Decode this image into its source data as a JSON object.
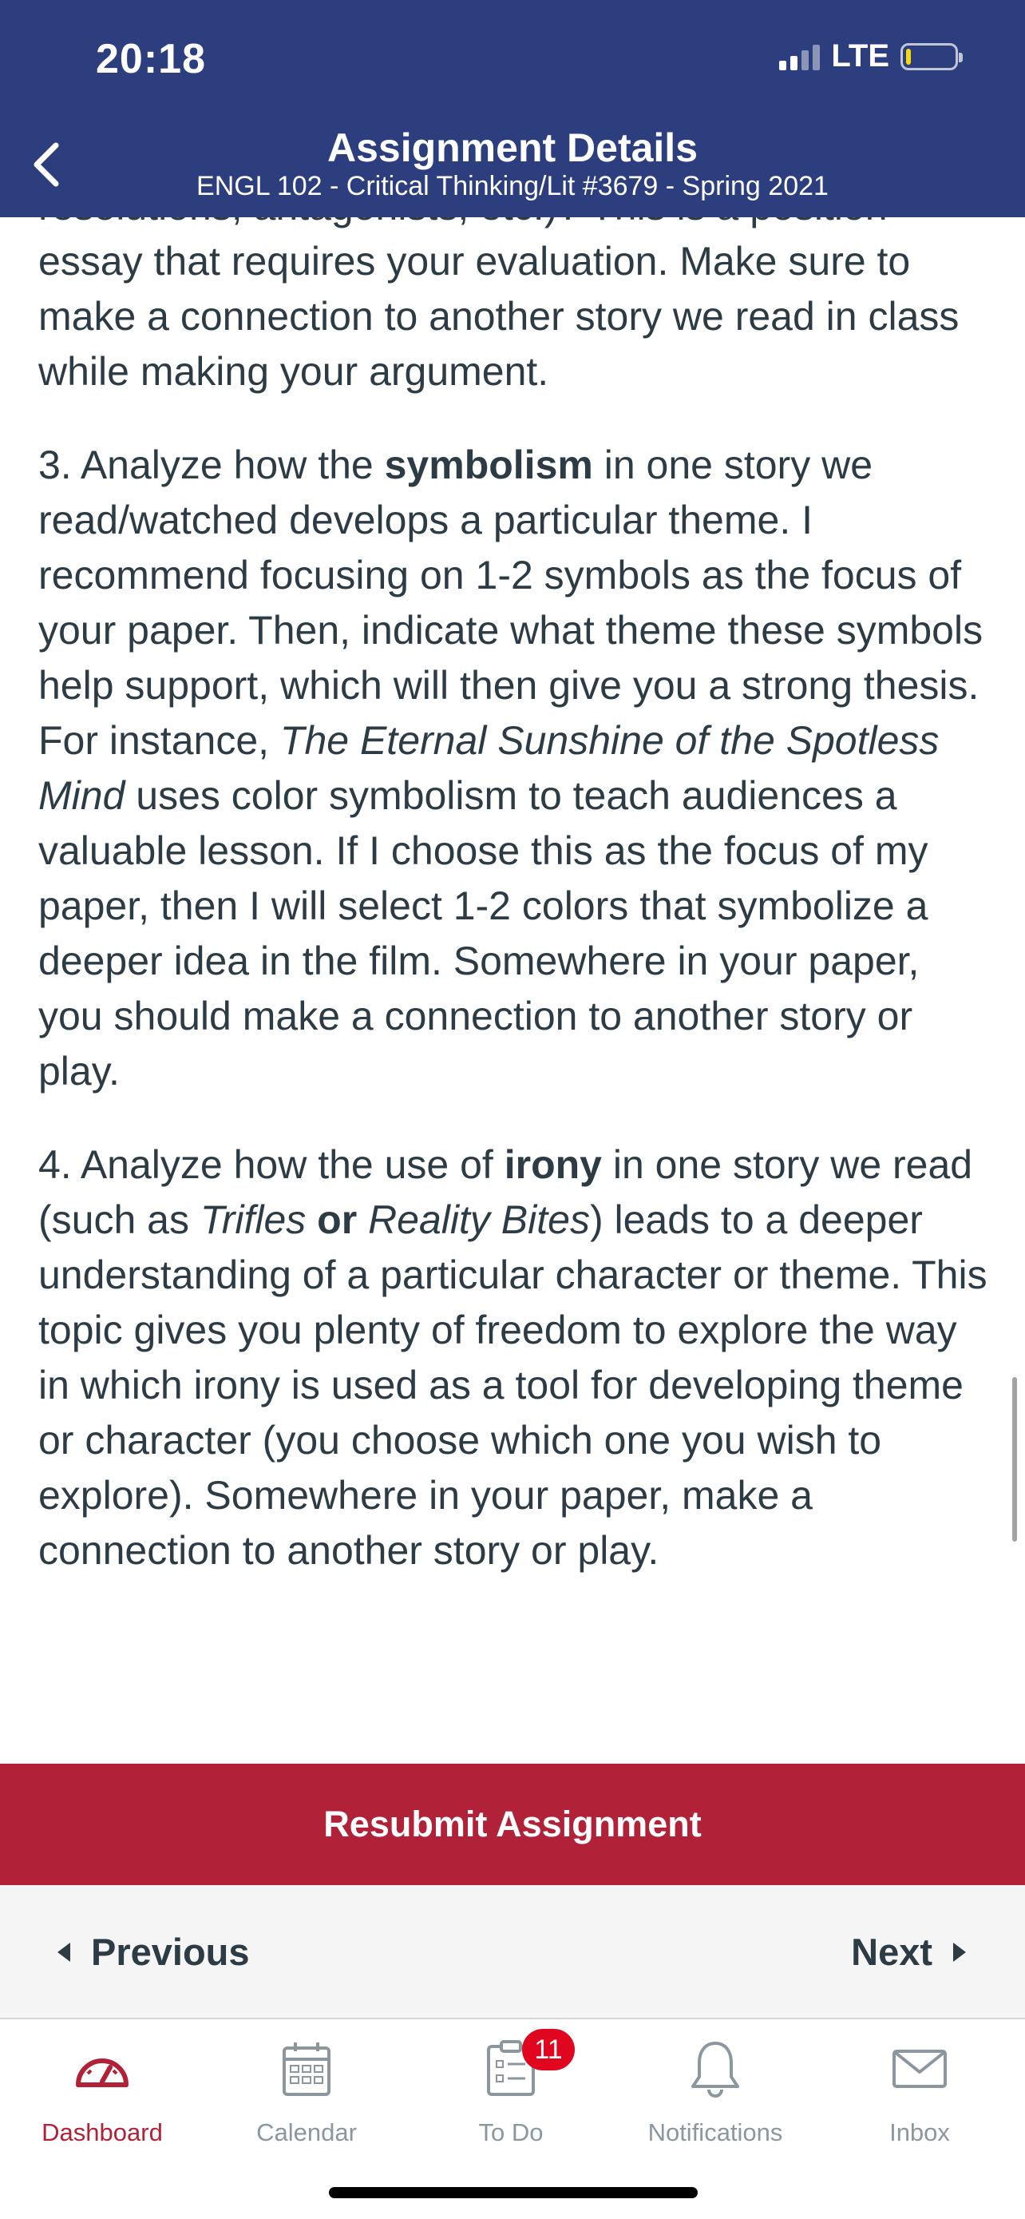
{
  "status_bar": {
    "time": "20:18",
    "network": "LTE",
    "battery_level": 0.1
  },
  "header": {
    "title": "Assignment Details",
    "subtitle": "ENGL 102 - Critical Thinking/Lit #3679 - Spring 2021",
    "back_icon": "chevron-left-icon"
  },
  "content": {
    "partial_line": "resolutions, antagonists, etc.)? This is a",
    "para2_tail": "position essay that requires your evaluation. Make sure to make a connection to another story we read in class while making your argument.",
    "para3": {
      "t1": "3. Analyze how the ",
      "b1": "symbolism",
      "t2": " in one story we read/watched develops a particular theme. I recommend focusing on 1-2 symbols as the focus of your paper. Then, indicate what theme these symbols help support, which will then give you a strong thesis. For instance, ",
      "i1": "The Eternal Sunshine of the Spotless Mind",
      "t3": " uses color symbolism to teach audiences a valuable lesson. If I choose this as the focus of my paper, then I will select 1-2 colors that symbolize a deeper idea in the film. Somewhere in your paper, you should make a connection to another story or play."
    },
    "para4": {
      "t1": "4. Analyze how the use of ",
      "b1": "irony",
      "t2": " in one story we read (such as ",
      "i1": "Trifles",
      "b2": "or",
      "i2": "Reality Bites",
      "t3": ") leads to a deeper understanding of a particular character or theme. This topic gives you plenty of freedom to explore the way in which irony is used as a tool for developing theme or character (you choose which one you wish to explore). Somewhere in your paper, make a connection to another story or play."
    }
  },
  "actions": {
    "resubmit_label": "Resubmit Assignment"
  },
  "pager": {
    "previous_label": "Previous",
    "next_label": "Next"
  },
  "tabbar": {
    "tabs": [
      {
        "label": "Dashboard",
        "icon": "dashboard-icon",
        "active": true
      },
      {
        "label": "Calendar",
        "icon": "calendar-icon",
        "active": false
      },
      {
        "label": "To Do",
        "icon": "todo-icon",
        "active": false,
        "badge": "11"
      },
      {
        "label": "Notifications",
        "icon": "bell-icon",
        "active": false
      },
      {
        "label": "Inbox",
        "icon": "mail-icon",
        "active": false
      }
    ]
  },
  "colors": {
    "header": "#2c3e7e",
    "accent": "#b12238",
    "badge": "#e0061f",
    "text": "#2d3b45",
    "muted": "#8b969e"
  }
}
